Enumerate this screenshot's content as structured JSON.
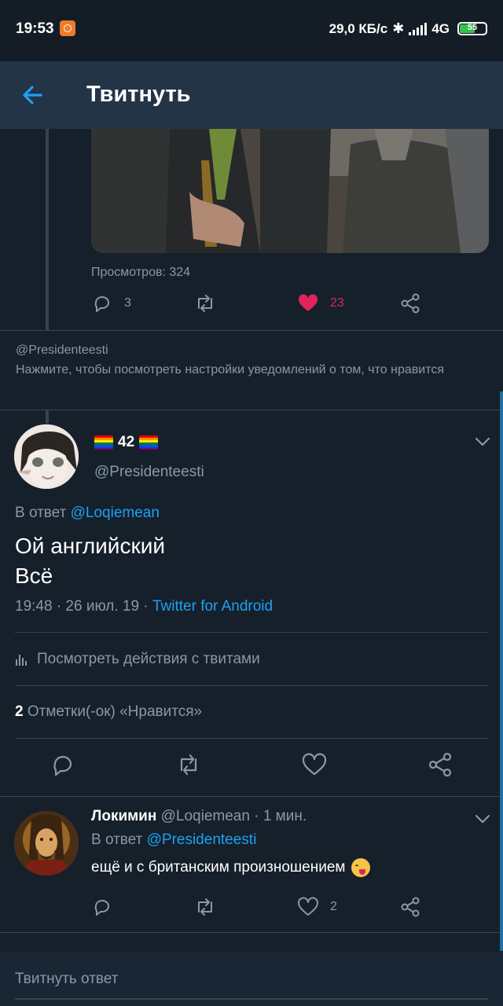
{
  "status_bar": {
    "time": "19:53",
    "network_speed": "29,0 КБ/с",
    "network_type": "4G",
    "battery": "55"
  },
  "app_bar": {
    "title": "Твитнуть",
    "back_icon": "arrow-left-icon"
  },
  "previous_tweet": {
    "views": "Просмотров: 324",
    "replies": "3",
    "likes": "23",
    "liked": true
  },
  "notification": {
    "handle": "@Presidenteesti",
    "text": "Нажмите, чтобы посмотреть настройки уведомлений о том, что нравится"
  },
  "main_tweet": {
    "display_name_number": "42",
    "handle": "@Presidenteesti",
    "reply_prefix": "В ответ",
    "reply_to": "@Loqiemean",
    "text_line1": "Ой английский",
    "text_line2": "Всё",
    "timestamp": "19:48 · 26 июл. 19 ·",
    "source": "Twitter for Android",
    "activity_link": "Посмотреть действия с твитами",
    "likes_count": "2",
    "likes_label": "Отметки(-ок) «Нравится»"
  },
  "reply_tweet": {
    "display_name": "Локимин",
    "handle": "@Loqiemean",
    "time_ago": "· 1 мин.",
    "reply_prefix": "В ответ",
    "reply_to": "@Presidenteesti",
    "text": "ещё и с британским произношением",
    "likes": "2"
  },
  "composer": {
    "placeholder": "Твитнуть ответ"
  },
  "colors": {
    "background": "#15202b",
    "accent": "#1da1f2",
    "like": "#e0245e",
    "muted": "#8899a6"
  }
}
